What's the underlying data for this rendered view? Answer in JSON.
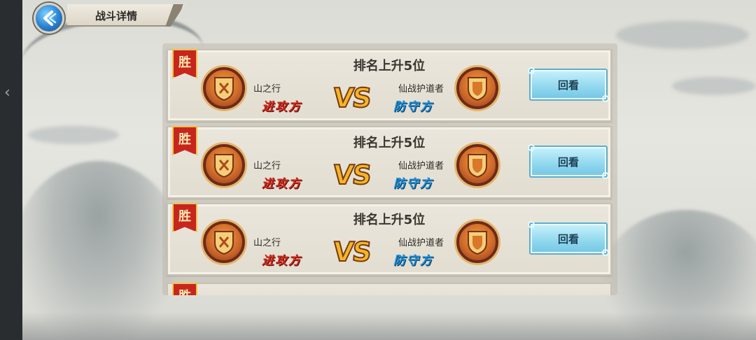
{
  "header": {
    "title": "战斗详情",
    "back_icon": "back-arrow-icon"
  },
  "colors": {
    "attacker": "#d12a1e",
    "defender": "#1f8fd6",
    "win_tag": "#c7261d",
    "replay_button": "#8fd7ef",
    "vs": "#f3b629"
  },
  "battles": [
    {
      "result": "胜",
      "rank_text": "排名上升5位",
      "attacker_name": "山之行",
      "attacker_role": "进攻方",
      "vs": "VS",
      "defender_name": "仙战护道者",
      "defender_role": "防守方",
      "replay_label": "回看"
    },
    {
      "result": "胜",
      "rank_text": "排名上升5位",
      "attacker_name": "山之行",
      "attacker_role": "进攻方",
      "vs": "VS",
      "defender_name": "仙战护道者",
      "defender_role": "防守方",
      "replay_label": "回看"
    },
    {
      "result": "胜",
      "rank_text": "排名上升5位",
      "attacker_name": "山之行",
      "attacker_role": "进攻方",
      "vs": "VS",
      "defender_name": "仙战护道者",
      "defender_role": "防守方",
      "replay_label": "回看"
    },
    {
      "result": "胜"
    }
  ]
}
